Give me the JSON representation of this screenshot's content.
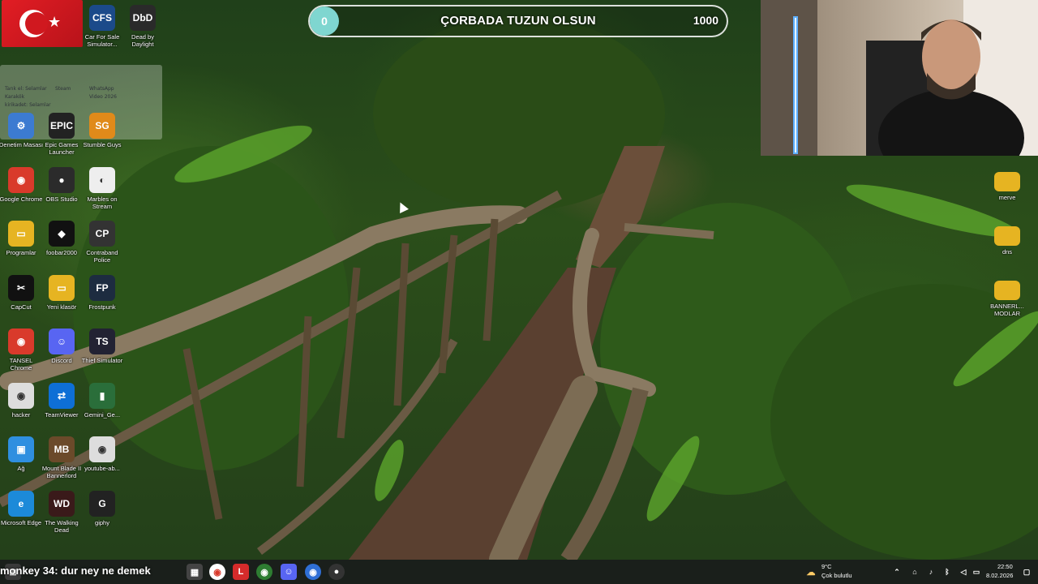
{
  "desktop": {
    "icons_left": [
      {
        "id": "car-for-sale",
        "label": "Car For Sale Simulator...",
        "glyph": "CFS",
        "color": "#1b4a8a"
      },
      {
        "id": "dead-by-daylight",
        "label": "Dead by Daylight",
        "glyph": "DbD",
        "color": "#2a2a2a"
      },
      {
        "id": "denetim-masasi",
        "label": "Denetim Masası",
        "glyph": "⚙",
        "color": "#3c7bd1"
      },
      {
        "id": "epic-games",
        "label": "Epic Games Launcher",
        "glyph": "EPIC",
        "color": "#222"
      },
      {
        "id": "stumble-guys",
        "label": "Stumble Guys",
        "glyph": "SG",
        "color": "#e08a1a"
      },
      {
        "id": "google-chrome",
        "label": "Google Chrome",
        "glyph": "◉",
        "color": "#d93a2b"
      },
      {
        "id": "obs-studio",
        "label": "OBS Studio",
        "glyph": "●",
        "color": "#2b2b2b"
      },
      {
        "id": "marbles-on-stream",
        "label": "Marbles on Stream",
        "glyph": "◐",
        "color": "#eee"
      },
      {
        "id": "programlar",
        "label": "Programlar",
        "glyph": "▭",
        "color": "#e6b422"
      },
      {
        "id": "foobar2000",
        "label": "foobar2000",
        "glyph": "◆",
        "color": "#111"
      },
      {
        "id": "contraband-police",
        "label": "Contraband Police",
        "glyph": "CP",
        "color": "#333"
      },
      {
        "id": "capcut",
        "label": "CapCut",
        "glyph": "✂",
        "color": "#111"
      },
      {
        "id": "yeni-klasor",
        "label": "Yeni klasör",
        "glyph": "▭",
        "color": "#e6b422"
      },
      {
        "id": "frostpunk",
        "label": "Frostpunk",
        "glyph": "FP",
        "color": "#1d2c40"
      },
      {
        "id": "tansel-chrome",
        "label": "TANSEL Chrome",
        "glyph": "◉",
        "color": "#d93a2b"
      },
      {
        "id": "discord",
        "label": "Discord",
        "glyph": "☺",
        "color": "#5865f2"
      },
      {
        "id": "thief-simulator",
        "label": "Thief Simulator",
        "glyph": "TS",
        "color": "#223"
      },
      {
        "id": "hacker",
        "label": "hacker",
        "glyph": "◉",
        "color": "#ddd"
      },
      {
        "id": "teamviewer",
        "label": "TeamViewer",
        "glyph": "⇄",
        "color": "#0e6fd6"
      },
      {
        "id": "gemini",
        "label": "Gemini_Ge...",
        "glyph": "▮",
        "color": "#2a6e3a"
      },
      {
        "id": "ag",
        "label": "Ağ",
        "glyph": "▣",
        "color": "#2f8fe0"
      },
      {
        "id": "mount-blade",
        "label": "Mount Blade II Bannerlord",
        "glyph": "MB",
        "color": "#6b4a2a"
      },
      {
        "id": "youtube-ab",
        "label": "youtube-ab...",
        "glyph": "◉",
        "color": "#ddd"
      },
      {
        "id": "microsoft-edge",
        "label": "Microsoft Edge",
        "glyph": "e",
        "color": "#1c8ad9"
      },
      {
        "id": "the-walking-dead",
        "label": "The Walking Dead",
        "glyph": "WD",
        "color": "#3a1a1a"
      },
      {
        "id": "giphy",
        "label": "giphy",
        "glyph": "G",
        "color": "#222"
      }
    ],
    "icons_right": [
      {
        "id": "merve",
        "label": "merve"
      },
      {
        "id": "dns",
        "label": "dns"
      },
      {
        "id": "bannerlord-modlar",
        "label": "BANNERL... MODLAR"
      }
    ]
  },
  "chat_overlay": {
    "lines": [
      "Tarık el: Selamlar",
      "Karakök",
      "kirikadet: Selamlar",
      "Steam",
      "WhatsApp",
      "Video 2026"
    ]
  },
  "goal_bar": {
    "current": "0",
    "title": "ÇORBADA TUZUN OLSUN",
    "target": "1000",
    "progress": 0
  },
  "taskbar": {
    "caption": "monkey 34: dur ney ne demek",
    "weather_temp": "9°C",
    "weather_desc": "Çok bulutlu",
    "time": "22:50",
    "date": "8.02.2026"
  },
  "colors": {
    "goal_knob": "#7fd6d0",
    "taskbar": "#1a1e1c",
    "folder": "#e6b422"
  }
}
